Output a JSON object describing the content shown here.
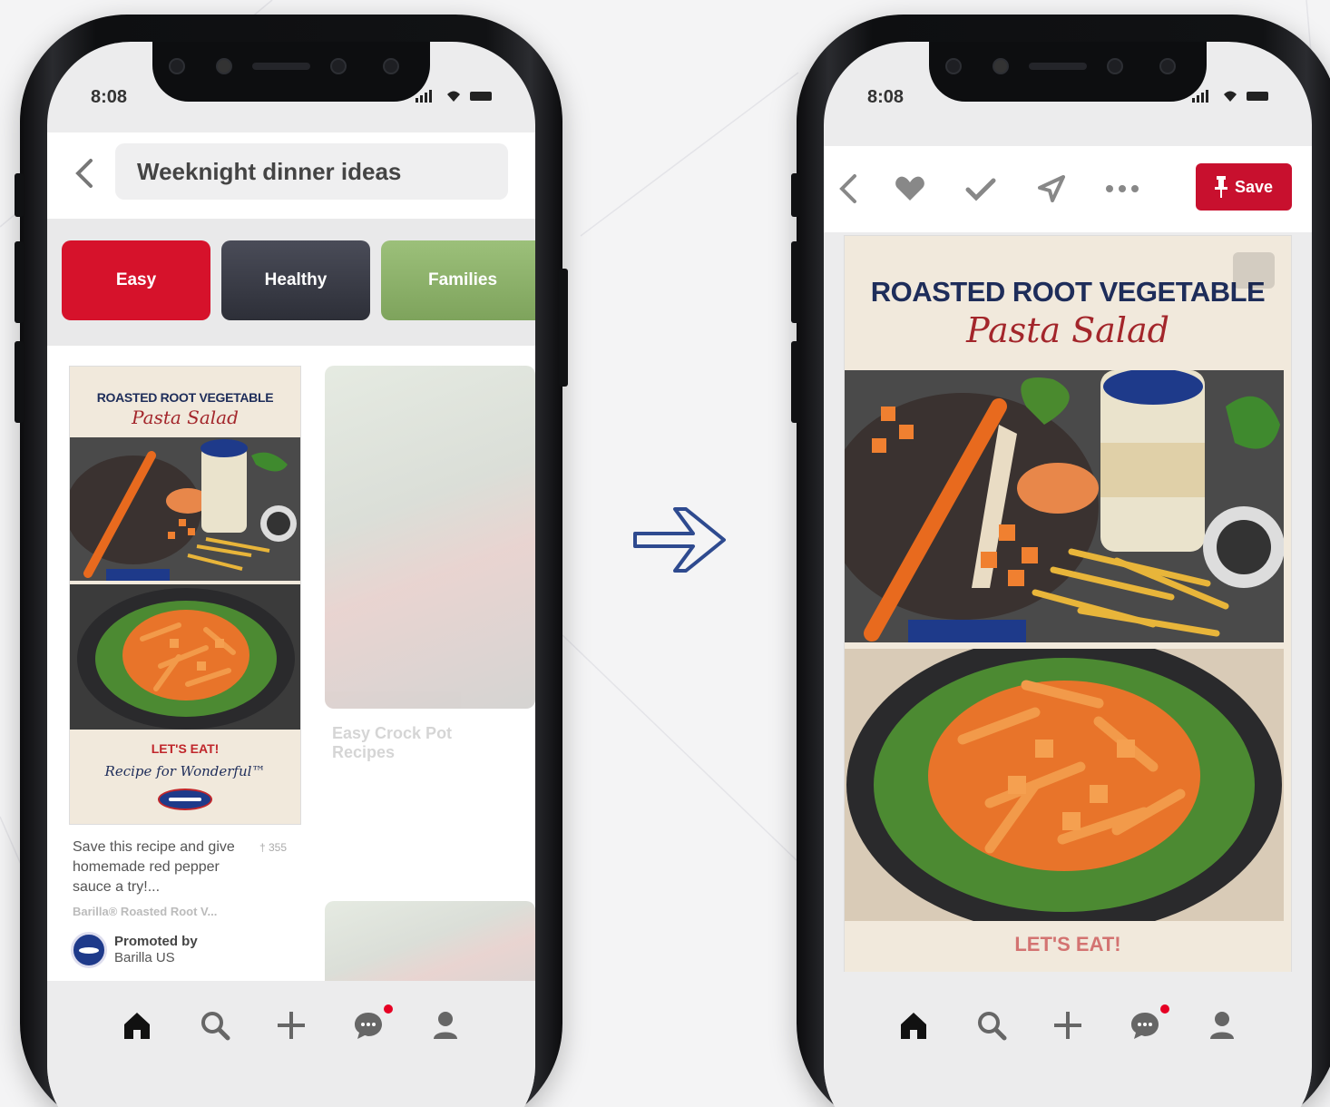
{
  "left_phone": {
    "status_time": "8:08",
    "search_query": "Weeknight dinner ideas",
    "chips": [
      {
        "label": "Easy",
        "color": "#d6122b"
      },
      {
        "label": "Healthy",
        "color": "#3a3c47"
      },
      {
        "label": "Families",
        "color": "#8fb56e"
      }
    ],
    "pin": {
      "title_top": "ROASTED ROOT VEGETABLE",
      "title_script": "Pasta Salad",
      "footer_tagline": "LET'S EAT!",
      "footer_script": "Recipe for Wonderful™",
      "description": "Save this recipe and give homemade red pepper sauce a try!...",
      "saves": "† 355",
      "source": "Barilla® Roasted Root V...",
      "promoted_label": "Promoted by",
      "promoted_by": "Barilla US"
    },
    "faded_pin": {
      "title": "Easy Crock Pot Recipes"
    }
  },
  "right_phone": {
    "status_time": "8:08",
    "save_label": "Save",
    "title_top": "ROASTED ROOT VEGETABLE",
    "title_script": "Pasta Salad",
    "bottom_peek_text": "LET'S EAT!"
  },
  "nav_icons": [
    "home-icon",
    "search-icon",
    "plus-icon",
    "chat-icon",
    "profile-icon"
  ],
  "colors": {
    "pinterest_red": "#e60023",
    "save_red": "#c8102e",
    "navy": "#1e2d5a",
    "script_red": "#a3262b",
    "arrow_blue": "#2e4a8f"
  }
}
